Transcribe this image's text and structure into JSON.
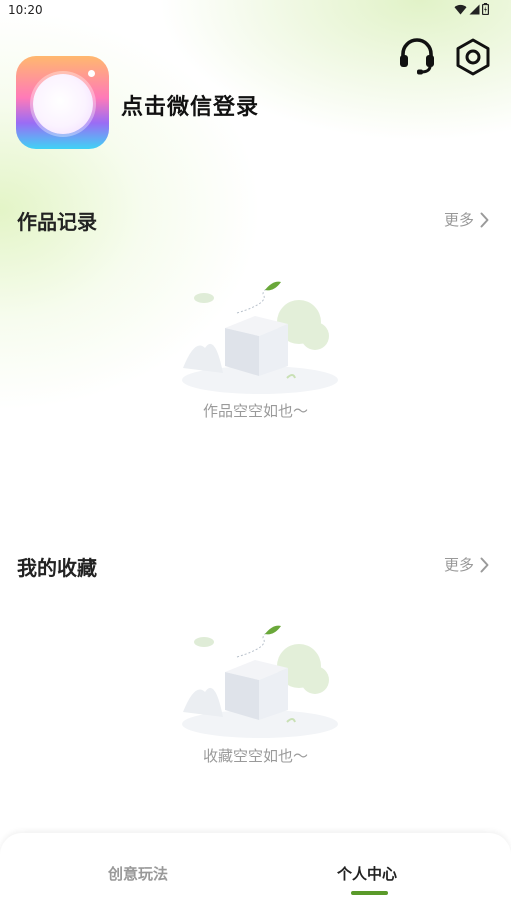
{
  "status_bar": {
    "time": "10:20",
    "icons": [
      "wifi-icon",
      "signal-icon",
      "battery-icon"
    ]
  },
  "header": {
    "login_prompt": "点击微信登录",
    "icons": [
      "customer-service-icon",
      "settings-icon"
    ]
  },
  "works": {
    "title": "作品记录",
    "more": "更多",
    "empty_text": "作品空空如也～"
  },
  "favorites": {
    "title": "我的收藏",
    "more": "更多",
    "empty_text": "收藏空空如也～"
  },
  "bottom_nav": {
    "items": [
      {
        "label": "创意玩法",
        "active": false
      },
      {
        "label": "个人中心",
        "active": true
      }
    ],
    "accent": "#5a9a2a"
  }
}
